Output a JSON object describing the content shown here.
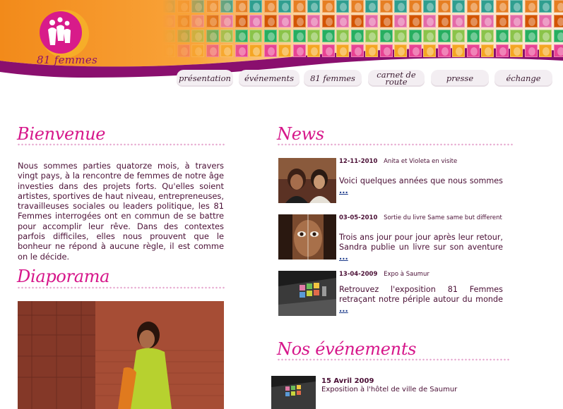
{
  "brand": {
    "logo_text": "81 femmes"
  },
  "nav": {
    "items": [
      {
        "label": "présentation"
      },
      {
        "label": "événements"
      },
      {
        "label": "81 femmes"
      },
      {
        "label": "carnet de route"
      },
      {
        "label": "presse"
      },
      {
        "label": "échange"
      }
    ]
  },
  "welcome": {
    "title": "Bienvenue",
    "text": "Nous sommes parties quatorze mois, à travers vingt pays, à la rencontre de femmes de notre âge investies dans des projets forts. Qu'elles soient artistes, sportives de haut niveau, entrepreneuses, travailleuses sociales ou leaders politique, les 81 Femmes interrogées ont en commun de se battre pour accomplir leur rêve. Dans des contextes parfois difficiles, elles nous prouvent que le bonheur ne répond à aucune règle, il est comme on le décide."
  },
  "slideshow": {
    "title": "Diaporama"
  },
  "news": {
    "title": "News",
    "more_label": "...",
    "items": [
      {
        "date": "12-11-2010",
        "headline": "Anita et Violeta en visite",
        "body": "Voici quelques années que nous sommes"
      },
      {
        "date": "03-05-2010",
        "headline": "Sortie du livre Same same but different",
        "body": "Trois ans jour pour jour après leur retour, Sandra publie un livre sur son aventure"
      },
      {
        "date": "13-04-2009",
        "headline": "Expo à Saumur",
        "body": "Retrouvez l'exposition 81 Femmes retraçant notre périple autour du monde"
      }
    ]
  },
  "events": {
    "title": "Nos événements",
    "items": [
      {
        "date": "15 Avril 2009",
        "description": "Exposition à l'hôtel de ville de Saumur"
      }
    ]
  },
  "colors": {
    "accent": "#d6168a",
    "header_orange": "#f7931e",
    "header_purple": "#8a0f6e",
    "text": "#4a0f35",
    "link": "#1b3a8a"
  }
}
